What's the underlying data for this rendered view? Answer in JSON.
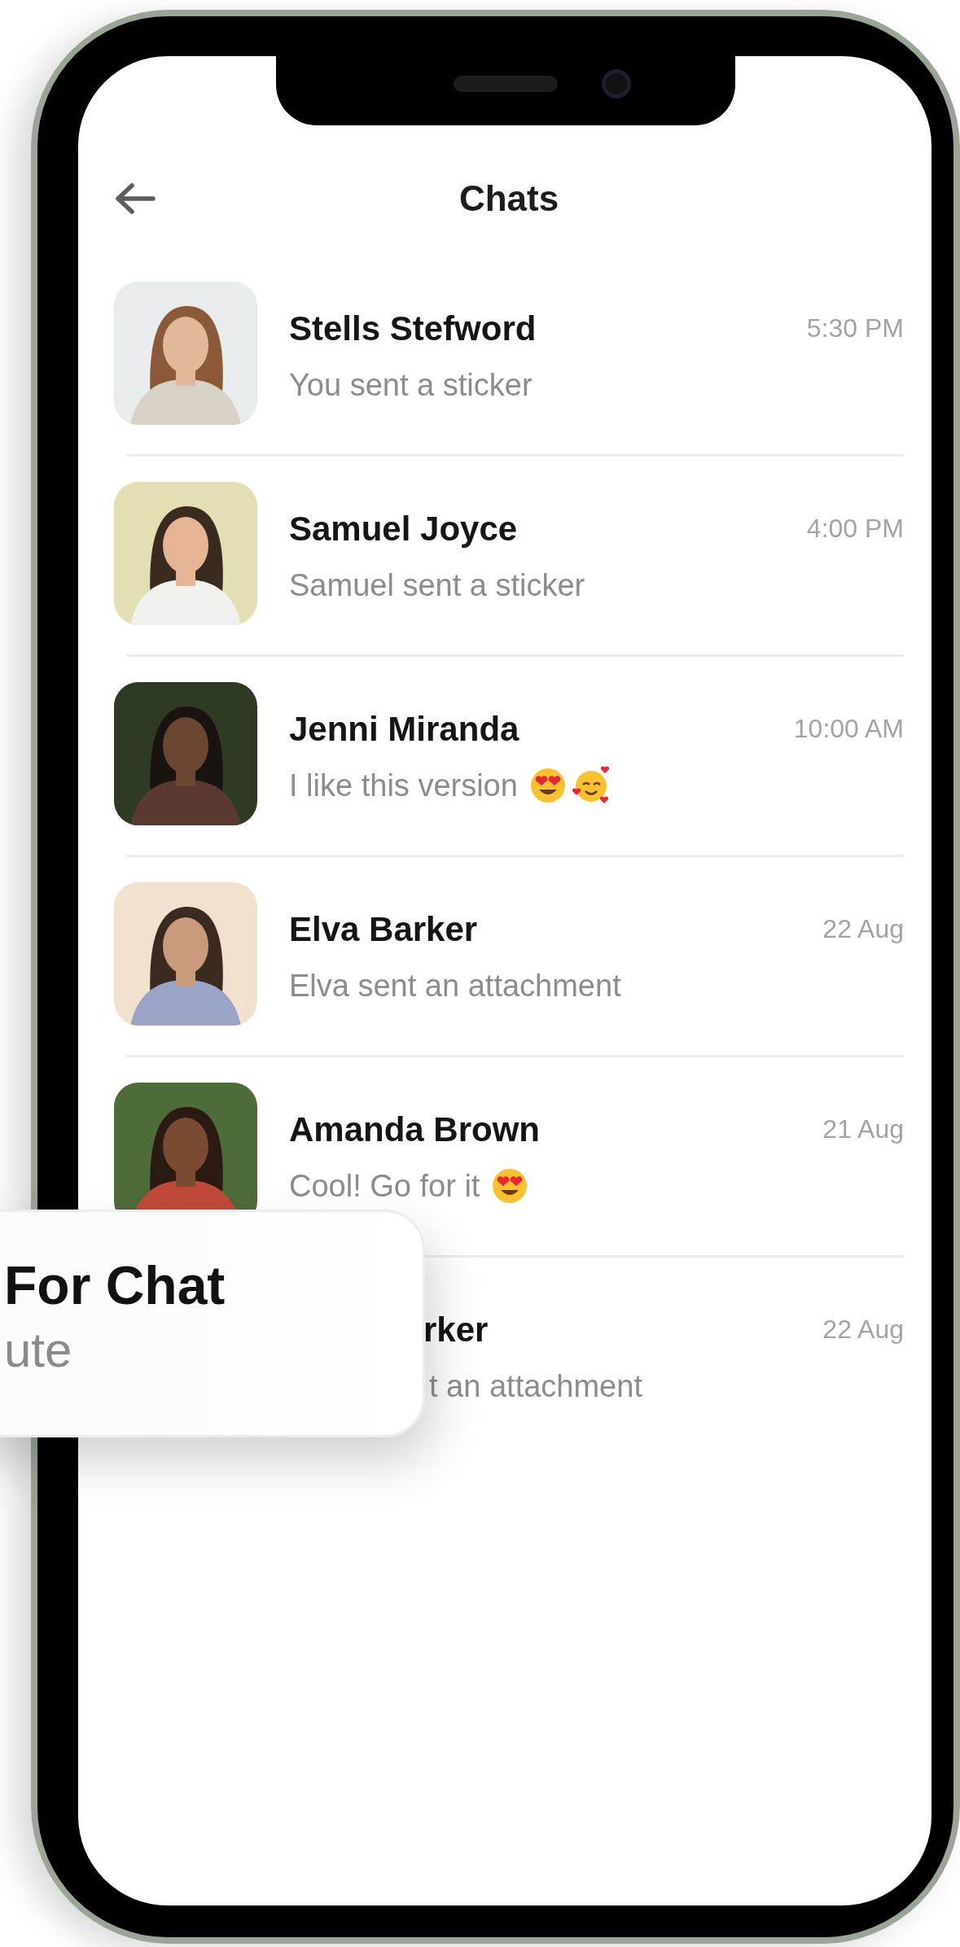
{
  "header": {
    "title": "Chats"
  },
  "chats": [
    {
      "name": "Stells Stefword",
      "preview": "You sent a sticker",
      "time": "5:30 PM"
    },
    {
      "name": "Samuel Joyce",
      "preview": "Samuel sent a sticker",
      "time": "4:00 PM"
    },
    {
      "name": "Jenni Miranda",
      "preview": "I like this version",
      "emoji": [
        {
          "kind": "heart-eyes"
        },
        {
          "kind": "smiling-hearts"
        }
      ],
      "time": "10:00 AM"
    },
    {
      "name": "Elva Barker",
      "preview": "Elva sent an attachment",
      "time": "22 Aug"
    },
    {
      "name": "Amanda Brown",
      "preview": "Cool! Go for it",
      "emoji": [
        {
          "kind": "heart-eyes"
        }
      ],
      "time": "21 Aug"
    },
    {
      "name": "rker",
      "preview": "t an attachment",
      "time": "22 Aug",
      "covered": true
    }
  ],
  "popup": {
    "title": "For Chat",
    "subtitle": "ute"
  }
}
